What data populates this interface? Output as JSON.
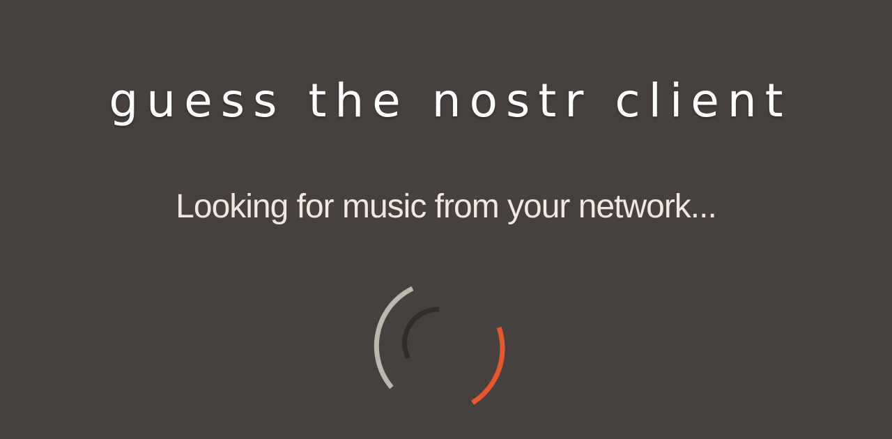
{
  "header": {
    "title": "guess the nostr client"
  },
  "status": {
    "message": "Looking for music from your network..."
  },
  "spinner": {
    "icon": "loading-spinner-icon",
    "colors": {
      "outer_arc": "#bdb8ae",
      "inner_arc": "#2f2d2b",
      "accent_arc": "#e8572a"
    }
  },
  "theme": {
    "background": "#46413f",
    "title_color": "#ffffff",
    "message_color": "#f2e6e1"
  }
}
